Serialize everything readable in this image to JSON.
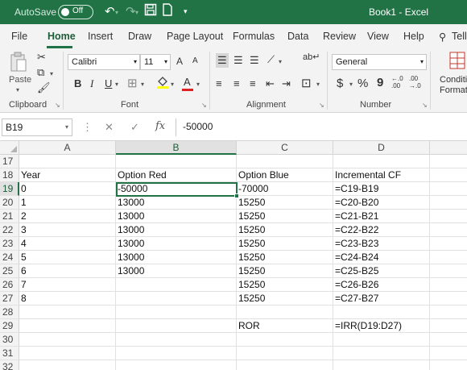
{
  "titlebar": {
    "autosave_label": "AutoSave",
    "autosave_state": "Off",
    "document_title": "Book1  -  Excel"
  },
  "ribbon_tabs": [
    "File",
    "Home",
    "Insert",
    "Draw",
    "Page Layout",
    "Formulas",
    "Data",
    "Review",
    "View",
    "Help",
    "Tell"
  ],
  "ribbon": {
    "clipboard": {
      "group_label": "Clipboard",
      "paste_label": "Paste"
    },
    "font": {
      "group_label": "Font",
      "font_name": "Calibri",
      "font_size": "11",
      "grow_label": "A",
      "shrink_label": "A",
      "bold": "B",
      "italic": "I",
      "underline": "U",
      "font_color_label": "A"
    },
    "alignment": {
      "group_label": "Alignment"
    },
    "number": {
      "group_label": "Number",
      "format": "General",
      "currency": "$",
      "percent": "%",
      "comma": "9",
      "inc_decimal": "←.0\n.00",
      "dec_decimal": ".00\n→.0"
    },
    "styles": {
      "conditional_label_1": "Conditi",
      "conditional_label_2": "Formatt"
    }
  },
  "formula_bar": {
    "name_box": "B19",
    "fx": "fx",
    "value": "-50000"
  },
  "sheet": {
    "columns": [
      "A",
      "B",
      "C",
      "D"
    ],
    "rows": [
      {
        "num": "17",
        "A": "",
        "B": "",
        "C": "",
        "D": ""
      },
      {
        "num": "18",
        "A": "Year",
        "B": "Option Red",
        "C": "Option Blue",
        "D": "Incremental CF"
      },
      {
        "num": "19",
        "A": "0",
        "B": "-50000",
        "C": "-70000",
        "D": "=C19-B19"
      },
      {
        "num": "20",
        "A": "1",
        "B": "13000",
        "C": "15250",
        "D": "=C20-B20"
      },
      {
        "num": "21",
        "A": "2",
        "B": "13000",
        "C": "15250",
        "D": "=C21-B21"
      },
      {
        "num": "22",
        "A": "3",
        "B": "13000",
        "C": "15250",
        "D": "=C22-B22"
      },
      {
        "num": "23",
        "A": "4",
        "B": "13000",
        "C": "15250",
        "D": "=C23-B23"
      },
      {
        "num": "24",
        "A": "5",
        "B": "13000",
        "C": "15250",
        "D": "=C24-B24"
      },
      {
        "num": "25",
        "A": "6",
        "B": "13000",
        "C": "15250",
        "D": "=C25-B25"
      },
      {
        "num": "26",
        "A": "7",
        "B": "",
        "C": "15250",
        "D": "=C26-B26"
      },
      {
        "num": "27",
        "A": "8",
        "B": "",
        "C": "15250",
        "D": "=C27-B27"
      },
      {
        "num": "28",
        "A": "",
        "B": "",
        "C": "",
        "D": ""
      },
      {
        "num": "29",
        "A": "",
        "B": "",
        "C": "ROR",
        "D": "=IRR(D19:D27)"
      },
      {
        "num": "30",
        "A": "",
        "B": "",
        "C": "",
        "D": ""
      },
      {
        "num": "31",
        "A": "",
        "B": "",
        "C": "",
        "D": ""
      },
      {
        "num": "32",
        "A": "",
        "B": "",
        "C": "",
        "D": ""
      }
    ],
    "active_cell": "B19"
  },
  "colors": {
    "excel_green": "#217346",
    "ribbon_bg": "#f3f3f3",
    "gridline": "#e1e1e1"
  }
}
